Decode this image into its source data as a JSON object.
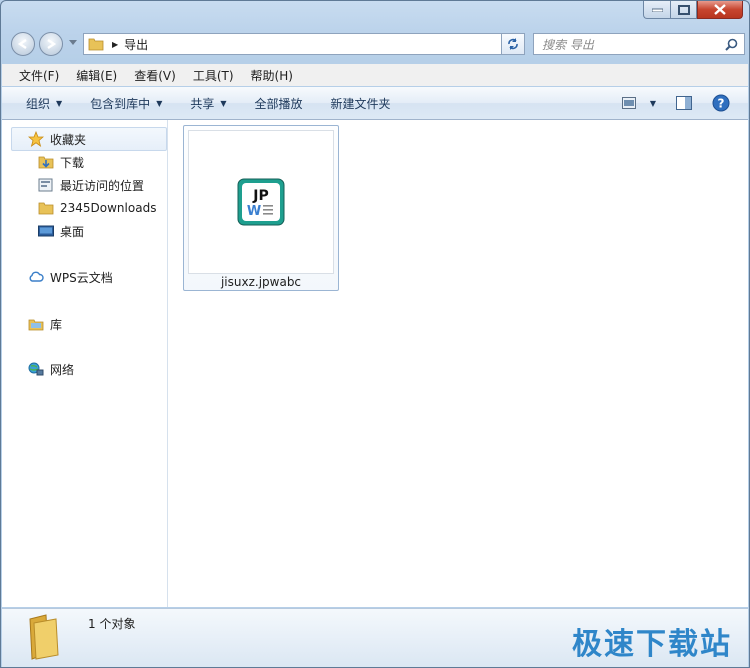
{
  "window": {
    "title": "导出"
  },
  "address": {
    "path": "导出",
    "search_placeholder": "搜索 导出"
  },
  "menu": [
    "文件(F)",
    "编辑(E)",
    "查看(V)",
    "工具(T)",
    "帮助(H)"
  ],
  "toolbar": {
    "organize": "组织",
    "include_library": "包含到库中",
    "share": "共享",
    "play_all": "全部播放",
    "new_folder": "新建文件夹"
  },
  "sidebar": {
    "favorites": "收藏夹",
    "items": [
      "下载",
      "最近访问的位置",
      "2345Downloads",
      "桌面"
    ],
    "wps": "WPS云文档",
    "library": "库",
    "network": "网络"
  },
  "files": [
    {
      "name": "jisuxz.jpwabc",
      "icon": "jpw-file-icon"
    }
  ],
  "status": {
    "count": "1 个对象",
    "watermark": "极速下载站"
  },
  "colors": {
    "accent": "#2f86c9",
    "icon_teal": "#1e9f8f"
  }
}
